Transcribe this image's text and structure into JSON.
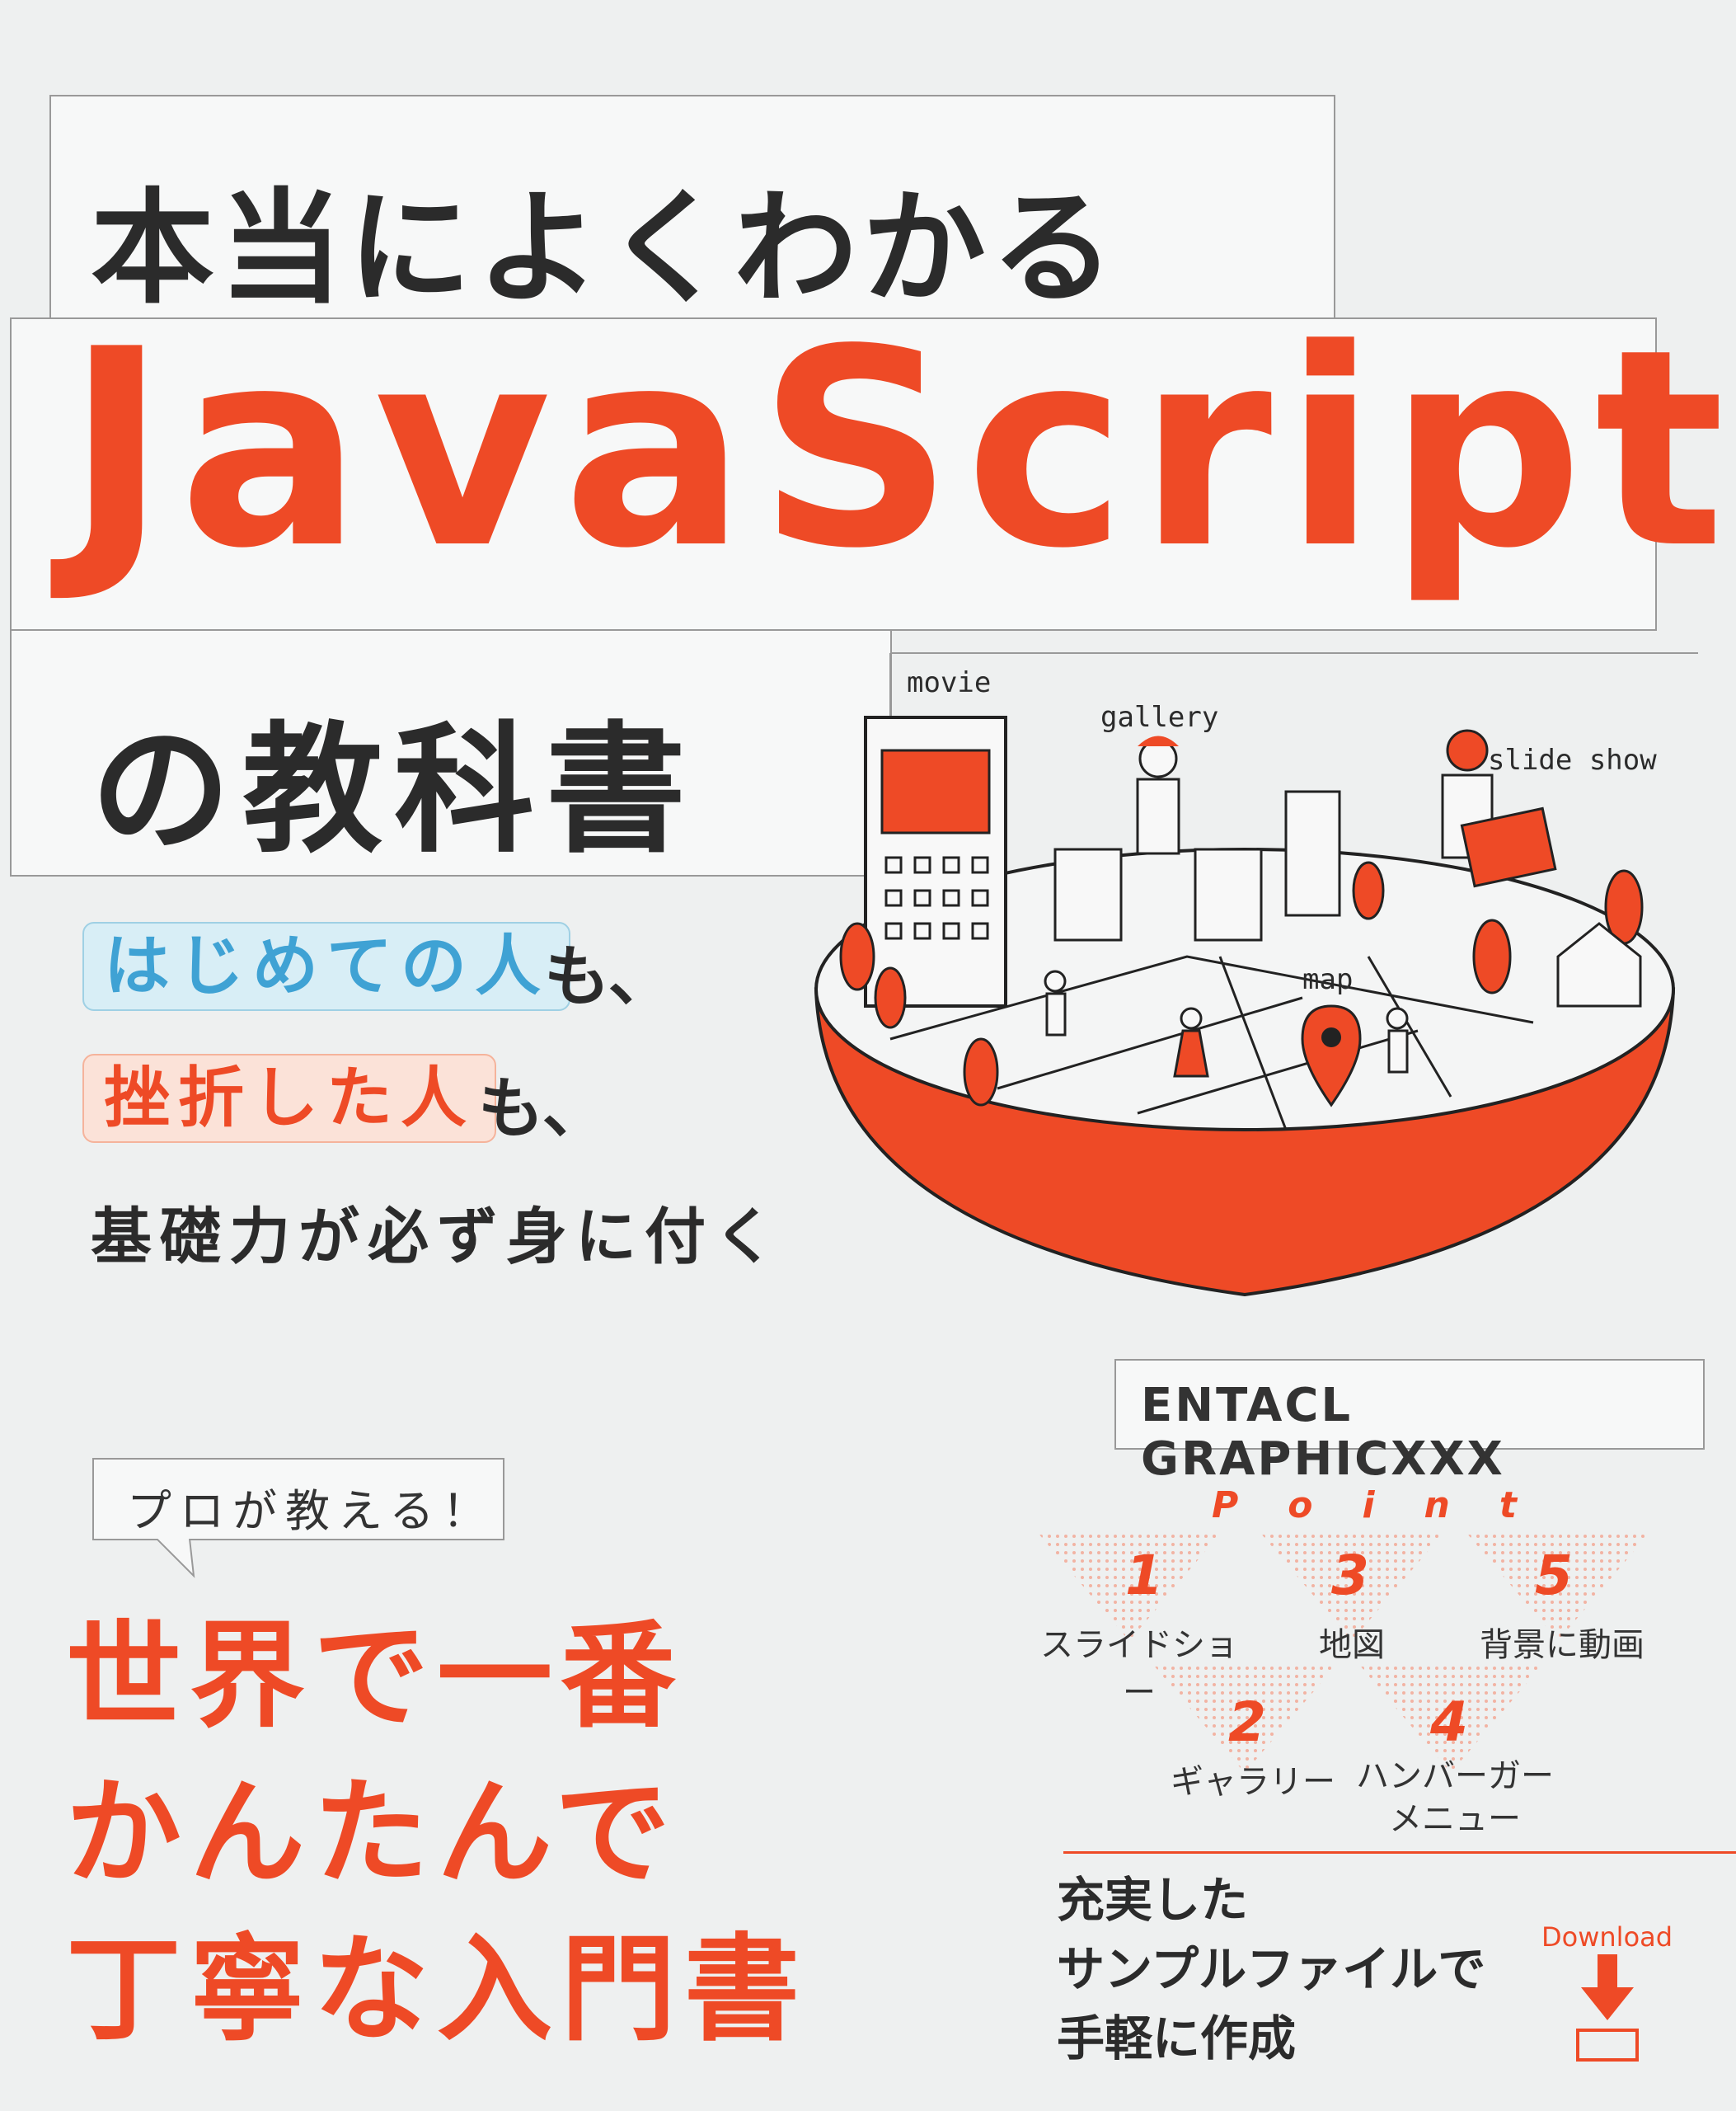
{
  "title": {
    "line1": "本当によくわかる",
    "line2": "JavaScript",
    "line3": "の教科書"
  },
  "lead": {
    "tag1": "はじめての人",
    "tag1_suffix": "も、",
    "tag2": "挫折した人",
    "tag2_suffix": "も、",
    "line3": "基礎力が必ず身に付く"
  },
  "illustration": {
    "labels": {
      "movie": "movie",
      "gallery": "gallery",
      "slideshow": "slide show",
      "map": "map"
    }
  },
  "author": "ENTACL GRAPHICXXX",
  "bubble": "プロが教える！",
  "headline": [
    "世界で一番",
    "かんたんで",
    "丁寧な入門書"
  ],
  "points": {
    "header": "Point",
    "items": [
      {
        "num": "1",
        "label": "スライドショー"
      },
      {
        "num": "2",
        "label": "ギャラリー"
      },
      {
        "num": "3",
        "label": "地図"
      },
      {
        "num": "4",
        "label": "ハンバーガー\nメニュー"
      },
      {
        "num": "5",
        "label": "背景に動画"
      }
    ]
  },
  "sample": "充実した\nサンプルファイルで\n手軽に作成",
  "download": "Download",
  "colors": {
    "accent": "#ee4a26",
    "blue": "#3fa2d4",
    "background": "#eef0f0"
  }
}
